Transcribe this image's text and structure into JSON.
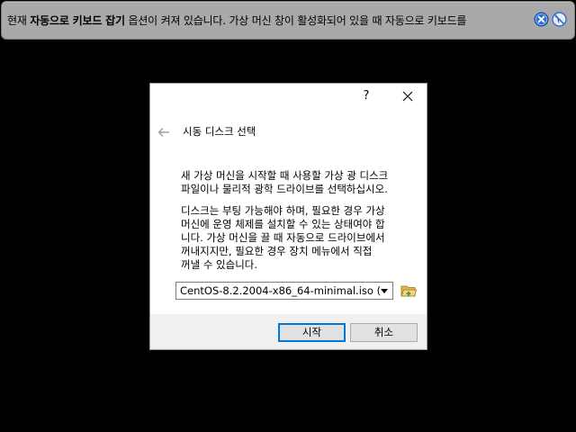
{
  "banner": {
    "text_prefix": "현재 ",
    "text_bold1": "자동으로 키보드 잡기",
    "text_middle": " 옵션이 켜져 있습니다. 가상 머신 창이 활성화되어 있을 때 자동으로 키보드를",
    "close_icon": "close-circle-icon",
    "mute_icon": "do-not-show-icon"
  },
  "dialog": {
    "help_label": "?",
    "page_title": "시동 디스크 선택",
    "paragraph1": "새 가상 머신을 시작할 때 사용할 가상 광 디스크\n파일이나 물리적 광학 드라이브를 선택하십시오.",
    "paragraph2": "디스크는 부팅 가능해야 하며, 필요한 경우 가상\n머신에 운영 체제를 설치할 수 있는 상태여야 합\n니다. 가상 머신을 끌 때 자동으로 드라이브에서\n꺼내지지만, 필요한 경우 장치 메뉴에서 직접\n꺼낼 수 있습니다.",
    "disk_selected": "CentOS-8.2.2004-x86_64-minimal.iso (",
    "start_label": "시작",
    "cancel_label": "취소"
  },
  "colors": {
    "banner_bg": "#a9a9a9",
    "accent": "#0078d7"
  }
}
